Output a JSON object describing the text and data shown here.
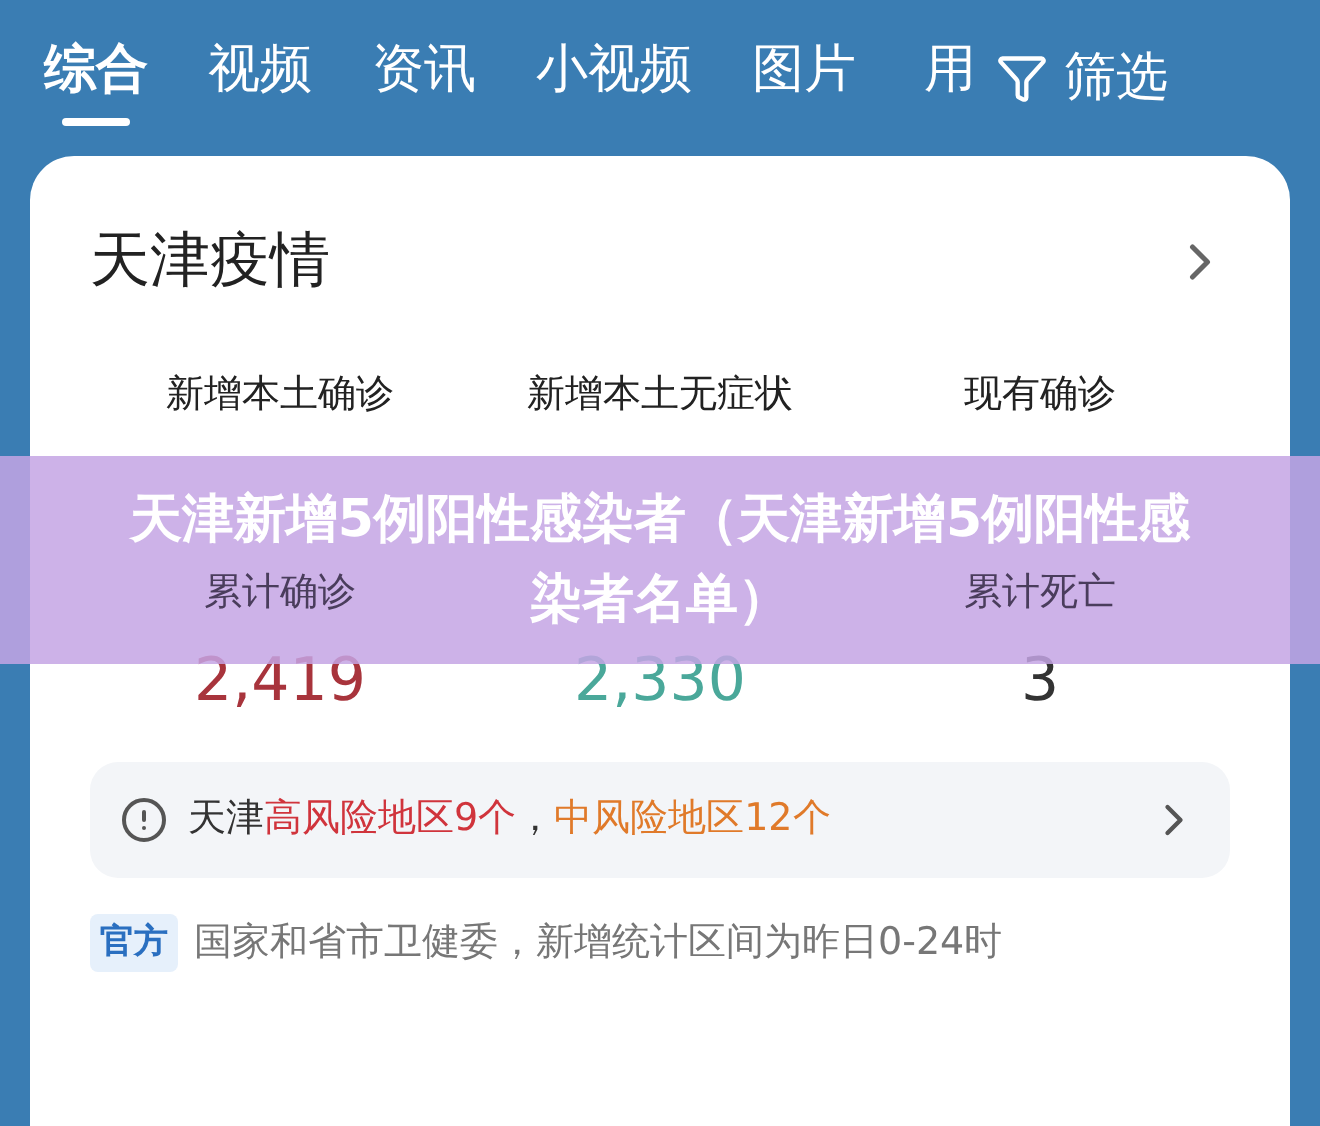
{
  "tabs": [
    {
      "label": "综合",
      "selected": true
    },
    {
      "label": "视频",
      "selected": false
    },
    {
      "label": "资讯",
      "selected": false
    },
    {
      "label": "小视频",
      "selected": false
    },
    {
      "label": "图片",
      "selected": false
    },
    {
      "label": "用",
      "selected": false
    }
  ],
  "filter": {
    "label": "筛选"
  },
  "card": {
    "title": "天津疫情",
    "top_labels": [
      "新增本土确诊",
      "新增本土无症状",
      "现有确诊"
    ],
    "stats": [
      {
        "label": "累计确诊",
        "value": "2,419",
        "color": "#a8343c"
      },
      {
        "value": "2,330",
        "color": "#4aa89a"
      },
      {
        "label": "累计死亡",
        "value": "3",
        "color": "#333333"
      }
    ],
    "risk": {
      "prefix": "天津",
      "high": "高风险地区9个",
      "separator": "，",
      "medium": "中风险地区12个"
    },
    "source": {
      "badge": "官方",
      "text": "国家和省市卫健委，新增统计区间为昨日0-24时"
    }
  },
  "banner": {
    "text": "天津新增5例阳性感染者（天津新增5例阳性感染者名单）"
  }
}
